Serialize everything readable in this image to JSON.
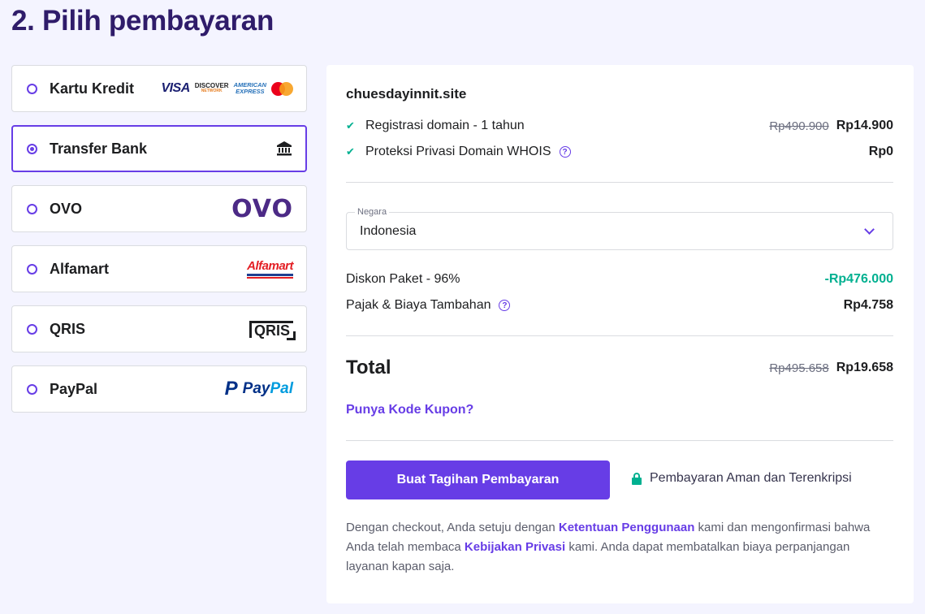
{
  "page_title": "2. Pilih pembayaran",
  "methods": [
    {
      "label": "Kartu Kredit",
      "selected": false,
      "logos": [
        "visa-logo",
        "discover-logo",
        "amex-logo",
        "mastercard-logo"
      ]
    },
    {
      "label": "Transfer Bank",
      "selected": true,
      "logos": [
        "bank-icon"
      ]
    },
    {
      "label": "OVO",
      "selected": false,
      "logos": [
        "ovo-logo"
      ]
    },
    {
      "label": "Alfamart",
      "selected": false,
      "logos": [
        "alfamart-logo"
      ]
    },
    {
      "label": "QRIS",
      "selected": false,
      "logos": [
        "qris-logo"
      ]
    },
    {
      "label": "PayPal",
      "selected": false,
      "logos": [
        "paypal-logo"
      ]
    }
  ],
  "logo_text": {
    "visa": "VISA",
    "discover": "DISCOVER",
    "discover_sub": "NETWORK",
    "amex_1": "AMERICAN",
    "amex_2": "EXPRESS",
    "ovo": "OVO",
    "alfa": "Alfa",
    "mart": "mart",
    "qris": "QRIS",
    "paypal_pay": "Pay",
    "paypal_pal": "Pal",
    "paypal_p": "P"
  },
  "summary": {
    "domain": "chuesdayinnit.site",
    "items": [
      {
        "label": "Registrasi domain - 1 tahun",
        "old_price": "Rp490.900",
        "price": "Rp14.900",
        "help": false
      },
      {
        "label": "Proteksi Privasi Domain WHOIS",
        "old_price": "",
        "price": "Rp0",
        "help": true
      }
    ],
    "country": {
      "legend": "Negara",
      "value": "Indonesia"
    },
    "discount": {
      "label": "Diskon Paket - 96%",
      "value": "-Rp476.000"
    },
    "tax": {
      "label": "Pajak & Biaya Tambahan",
      "value": "Rp4.758"
    },
    "total": {
      "label": "Total",
      "old_price": "Rp495.658",
      "price": "Rp19.658"
    },
    "coupon": "Punya Kode Kupon?",
    "pay_button": "Buat Tagihan Pembayaran",
    "secure_text": "Pembayaran Aman dan Terenkripsi",
    "legal": {
      "part1": "Dengan checkout, Anda setuju dengan ",
      "link1": "Ketentuan Penggunaan",
      "part2": " kami dan mengonfirmasi bahwa Anda telah membaca ",
      "link2": "Kebijakan Privasi",
      "part3": " kami. Anda dapat membatalkan biaya perpanjangan layanan kapan saja."
    }
  },
  "colors": {
    "accent": "#673de6",
    "success": "#00b090",
    "title": "#2f1c6a"
  }
}
